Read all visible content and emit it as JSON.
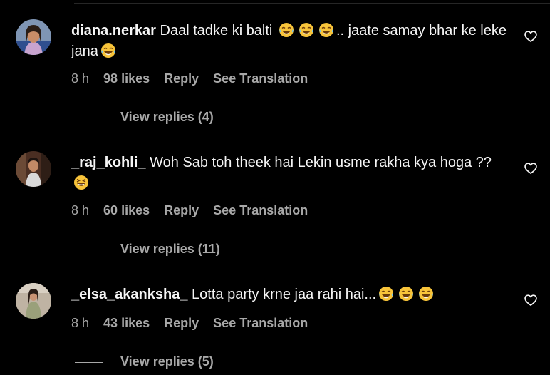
{
  "colors": {
    "background": "#000000",
    "text_primary": "#f5f5f5",
    "text_secondary": "#a8a8a8"
  },
  "comments": [
    {
      "username": "diana.nerkar",
      "text_part1": "Daal tadke ki balti",
      "text_part2": ".. jaate samay bhar ke leke jana",
      "emoji_name": "face-with-tears-of-joy",
      "time": "8 h",
      "likes": "98 likes",
      "reply_label": "Reply",
      "translation_label": "See Translation",
      "view_replies": "View replies (4)",
      "like_icon": "heart-outline-icon"
    },
    {
      "username": "_raj_kohli_",
      "text_part1": "Woh Sab toh theek hai Lekin usme rakha kya hoga ??",
      "emoji_name": "grinning-squinting-face",
      "time": "8 h",
      "likes": "60 likes",
      "reply_label": "Reply",
      "translation_label": "See Translation",
      "view_replies": "View replies (11)",
      "like_icon": "heart-outline-icon"
    },
    {
      "username": "_elsa_akanksha_",
      "text_part1": "Lotta party krne jaa rahi hai...",
      "emoji_name": "face-with-tears-of-joy",
      "time": "8 h",
      "likes": "43 likes",
      "reply_label": "Reply",
      "translation_label": "See Translation",
      "view_replies": "View replies (5)",
      "like_icon": "heart-outline-icon"
    }
  ]
}
